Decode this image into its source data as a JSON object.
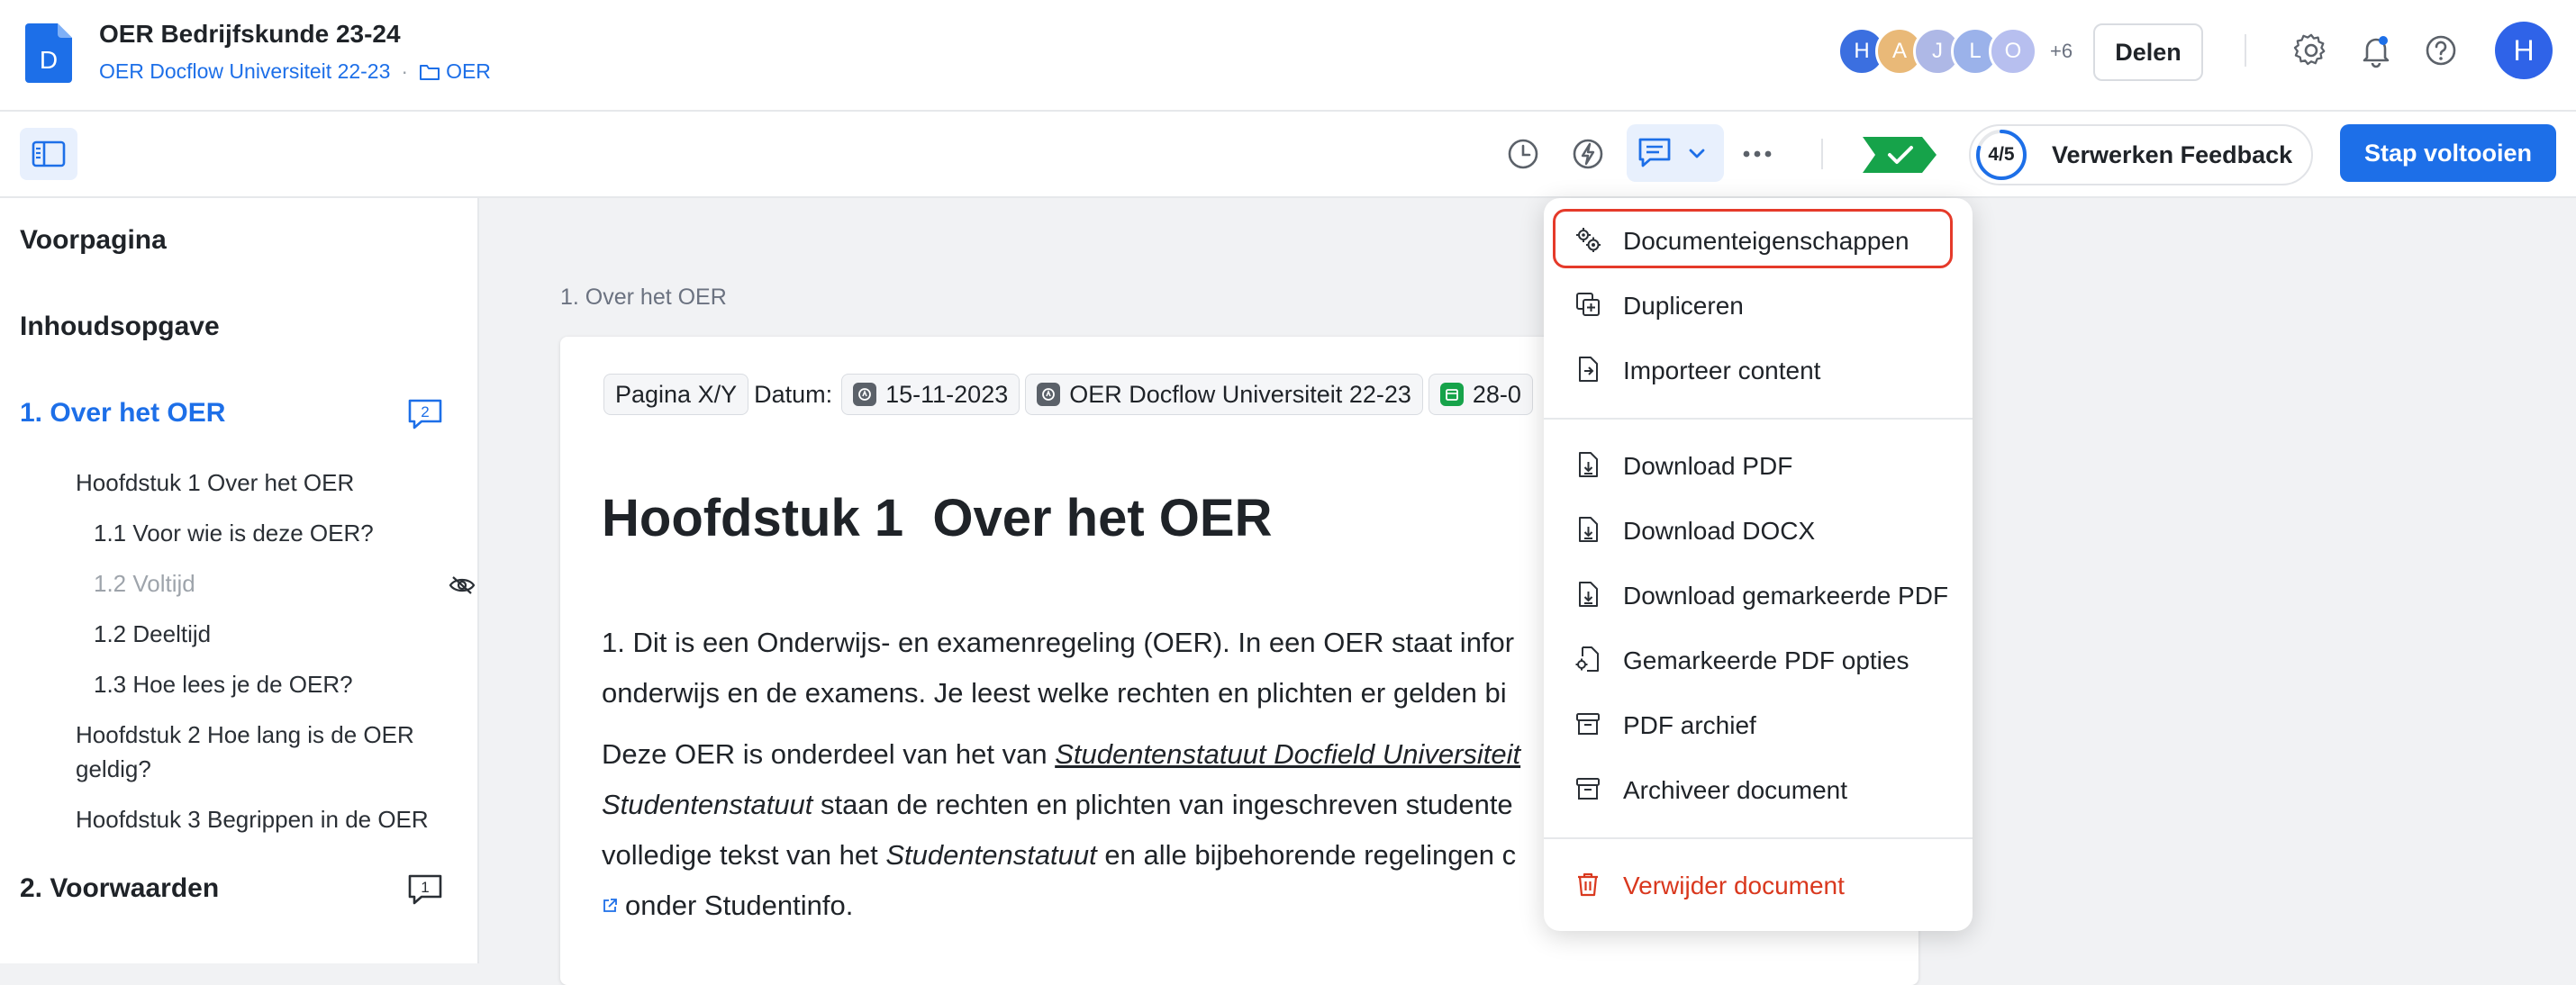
{
  "header": {
    "doc_title": "OER Bedrijfskunde 23-24",
    "breadcrumb_parent": "OER Docflow Universiteit 22-23",
    "breadcrumb_separator": "·",
    "breadcrumb_folder": "OER",
    "doc_icon_letter": "D",
    "avatars": [
      {
        "initial": "H",
        "color": "#3b6fe0"
      },
      {
        "initial": "A",
        "color": "#e9b978"
      },
      {
        "initial": "J",
        "color": "#aeb8e6"
      },
      {
        "initial": "L",
        "color": "#9bb2ea"
      },
      {
        "initial": "O",
        "color": "#b7bfef"
      }
    ],
    "avatars_more": "+6",
    "share_label": "Delen",
    "user_initial": "H"
  },
  "toolbar": {
    "progress_text": "4/5",
    "progress_value": 0.8,
    "progress_label": "Verwerken Feedback",
    "primary_label": "Stap voltooien"
  },
  "sidebar": {
    "voorpagina": "Voorpagina",
    "inhoud": "Inhoudsopgave",
    "section1": "1. Over het OER",
    "section1_comments": "2",
    "sub": [
      "Hoofdstuk 1 Over het OER",
      "1.1 Voor wie is deze OER?",
      "1.2 Voltijd",
      "1.2 Deeltijd",
      "1.3 Hoe lees je de OER?",
      "Hoofdstuk 2 Hoe lang is de OER geldig?",
      "Hoofdstuk 3 Begrippen in de OER"
    ],
    "section2": "2. Voorwaarden",
    "section2_comments": "1"
  },
  "main": {
    "section_label": "1. Over het OER",
    "meta": {
      "page": "Pagina X/Y",
      "date_label": "Datum:",
      "date": "15-11-2023",
      "org": "OER Docflow Universiteit 22-23",
      "partial": "28-0"
    },
    "heading": "Hoofdstuk 1  Over het OER",
    "para1_line1": "1.  Dit is een Onderwijs- en examenregeling (OER). In een OER staat infor",
    "para1_line2": "onderwijs en de examens. Je leest welke rechten en plichten er gelden bi",
    "para2_a": "Deze OER is onderdeel van het van ",
    "para2_link": "Studentenstatuut Docfield Universiteit",
    "para2_b_italic": "Studentenstatuut",
    "para2_b": " staan de rechten en plichten van ingeschreven studente",
    "para2_c": "volledige tekst van het ",
    "para2_c_italic": "Studentenstatuut",
    "para2_c_rest": " en alle bijbehorende regelingen c",
    "para2_d": " onder Studentinfo."
  },
  "menu": {
    "properties": "Documenteigenschappen",
    "duplicate": "Dupliceren",
    "import": "Importeer content",
    "pdf": "Download PDF",
    "docx": "Download DOCX",
    "marked_pdf": "Download gemarkeerde PDF",
    "marked_options": "Gemarkeerde PDF opties",
    "archive_pdf": "PDF archief",
    "archive_doc": "Archiveer document",
    "delete": "Verwijder document"
  },
  "colors": {
    "accent": "#1d6fe8",
    "danger": "#d9381e",
    "highlight": "#e53a2a",
    "success": "#16a34a"
  }
}
